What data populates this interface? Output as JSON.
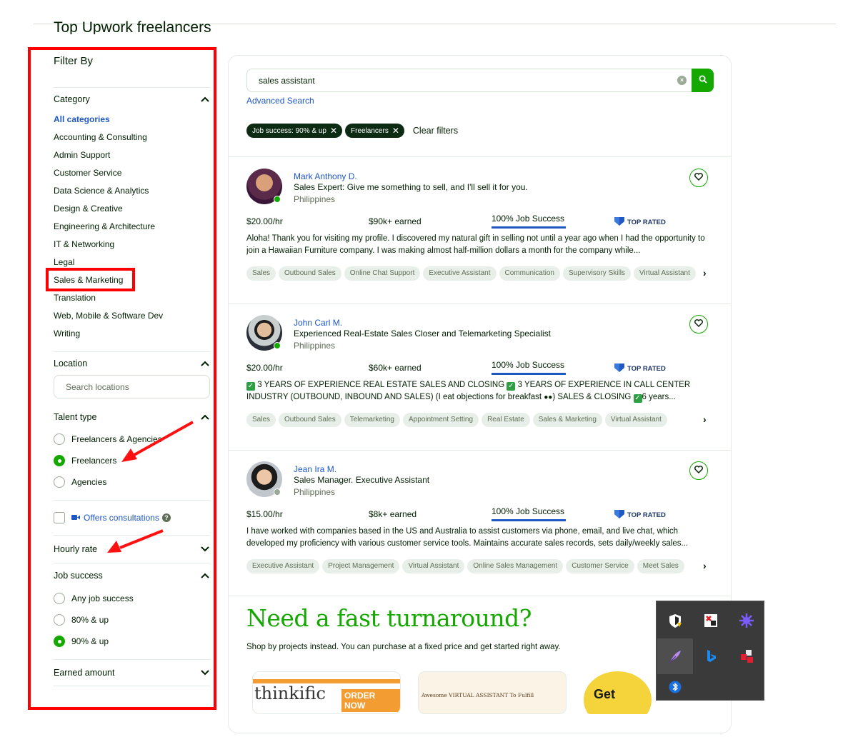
{
  "page": {
    "title": "Top Upwork freelancers"
  },
  "sidebar": {
    "filter_title": "Filter By",
    "category": {
      "label": "Category",
      "items": [
        "All categories",
        "Accounting & Consulting",
        "Admin Support",
        "Customer Service",
        "Data Science & Analytics",
        "Design & Creative",
        "Engineering & Architecture",
        "IT & Networking",
        "Legal",
        "Sales & Marketing",
        "Translation",
        "Web, Mobile & Software Dev",
        "Writing"
      ]
    },
    "location": {
      "label": "Location",
      "placeholder": "Search locations"
    },
    "talent_type": {
      "label": "Talent type",
      "options": [
        "Freelancers & Agencies",
        "Freelancers",
        "Agencies"
      ],
      "selected": "Freelancers"
    },
    "consultations": {
      "label": "Offers consultations"
    },
    "hourly_rate": {
      "label": "Hourly rate"
    },
    "job_success": {
      "label": "Job success",
      "options": [
        "Any job success",
        "80% & up",
        "90% & up"
      ],
      "selected": "90% & up"
    },
    "earned_amount": {
      "label": "Earned amount"
    }
  },
  "search": {
    "value": "sales assistant",
    "advanced_label": "Advanced Search",
    "chips": [
      "Job success: 90% & up",
      "Freelancers"
    ],
    "clear_label": "Clear filters"
  },
  "freelancers": [
    {
      "name": "Mark Anthony D.",
      "headline": "Sales Expert: Give me something to sell, and I'll sell it for you.",
      "country": "Philippines",
      "rate": "$20.00/hr",
      "earned": "$90k+ earned",
      "jss": "100% Job Success",
      "badge": "TOP RATED",
      "desc": "Aloha! Thank you for visiting my profile. I discovered my natural gift in selling not until a year ago when I had the opportunity to join a Hawaiian Furniture company. I was making almost half-million dollars a month for the company while...",
      "skills": [
        "Sales",
        "Outbound Sales",
        "Online Chat Support",
        "Executive Assistant",
        "Communication",
        "Supervisory Skills",
        "Virtual Assistant"
      ],
      "online": true
    },
    {
      "name": "John Carl M.",
      "headline": "Experienced Real-Estate Sales Closer and Telemarketing Specialist",
      "country": "Philippines",
      "rate": "$20.00/hr",
      "earned": "$60k+ earned",
      "jss": "100% Job Success",
      "badge": "TOP RATED",
      "desc_lines": [
        "3 YEARS OF EXPERIENCE REAL ESTATE SALES AND CLOSING",
        "3 YEARS OF EXPERIENCE IN CALL CENTER INDUSTRY (OUTBOUND, INBOUND AND SALES) (I eat objections for breakfast",
        ") SALES & CLOSING",
        "6 years..."
      ],
      "skills": [
        "Sales",
        "Outbound Sales",
        "Telemarketing",
        "Appointment Setting",
        "Real Estate",
        "Sales & Marketing",
        "Virtual Assistant"
      ],
      "online": true
    },
    {
      "name": "Jean Ira M.",
      "headline": "Sales Manager. Executive Assistant",
      "country": "Philippines",
      "rate": "$15.00/hr",
      "earned": "$8k+ earned",
      "jss": "100% Job Success",
      "badge": "TOP RATED",
      "desc": "I have worked with companies based in the US and Australia to assist customers via phone, email, and live chat, which developed my proficiency with various customer service tools. Maintains accurate sales records, sets daily/weekly sales...",
      "skills": [
        "Executive Assistant",
        "Project Management",
        "Virtual Assistant",
        "Online Sales Management",
        "Customer Service",
        "Meet Sales"
      ],
      "online": false
    }
  ],
  "promo": {
    "title": "Need a fast turnaround?",
    "subtitle": "Shop by projects instead. You can purchase at a fixed price and get started right away.",
    "cards": [
      "thinkific",
      "ORDER NOW",
      "Awesome VIRTUAL ASSISTANT To Fulfill",
      "Get"
    ]
  },
  "colors": {
    "brand_green": "#14a800",
    "link_blue": "#1f57c3",
    "annotation_red": "#ff0000"
  },
  "icons": [
    "search-icon",
    "chevron-up-icon",
    "chevron-down-icon",
    "heart-icon",
    "video-icon",
    "help-icon",
    "top-rated-badge-icon",
    "close-icon",
    "chevron-right-icon"
  ]
}
